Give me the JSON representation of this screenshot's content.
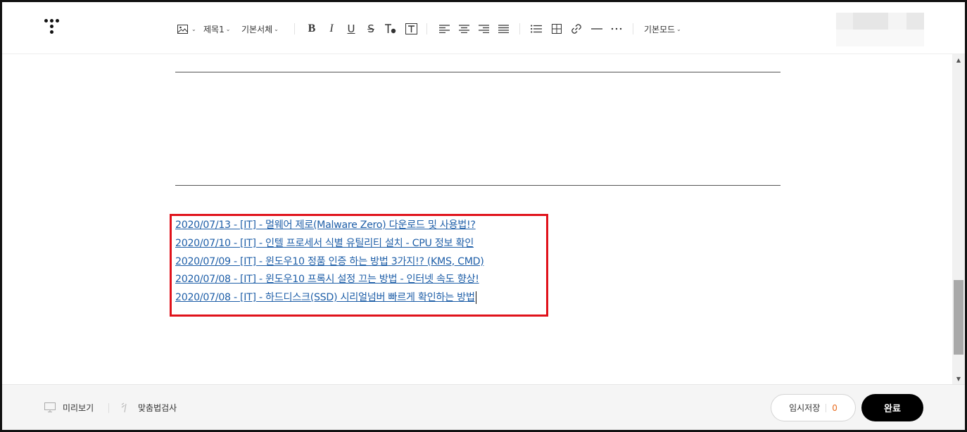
{
  "toolbar": {
    "heading_label": "제목1",
    "font_label": "기본서체",
    "mode_label": "기본모드",
    "icons": [
      "image-icon",
      "bold-icon",
      "italic-icon",
      "underline-icon",
      "strikethrough-icon",
      "text-color-icon",
      "text-background-icon",
      "align-left-icon",
      "align-center-icon",
      "align-right-icon",
      "align-justify-icon",
      "list-icon",
      "table-icon",
      "link-icon",
      "horizontal-rule-icon",
      "more-icon"
    ]
  },
  "editor": {
    "links": [
      "2020/07/13 - [IT] - 멀웨어 제로(Malware Zero) 다운로드 및 사용법!?",
      "2020/07/10 - [IT] - 인텔 프로세서 식별 유틸리티 설치 - CPU 정보 확인",
      "2020/07/09 - [IT] - 윈도우10 정품 인증 하는 방법 3가지!? (KMS, CMD)",
      "2020/07/08 - [IT] - 윈도우10 프록시 설정 끄는 방법 - 인터넷 속도 향상!",
      "2020/07/08 - [IT] - 하드디스크(SSD) 시리얼넘버 빠르게 확인하는 방법"
    ],
    "link_color": "#1f5fa8",
    "highlight_color": "#e0121b"
  },
  "footer": {
    "preview_label": "미리보기",
    "spellcheck_label": "맞춤법검사",
    "temp_save_label": "임시저장",
    "temp_save_count": "0",
    "done_label": "완료"
  }
}
